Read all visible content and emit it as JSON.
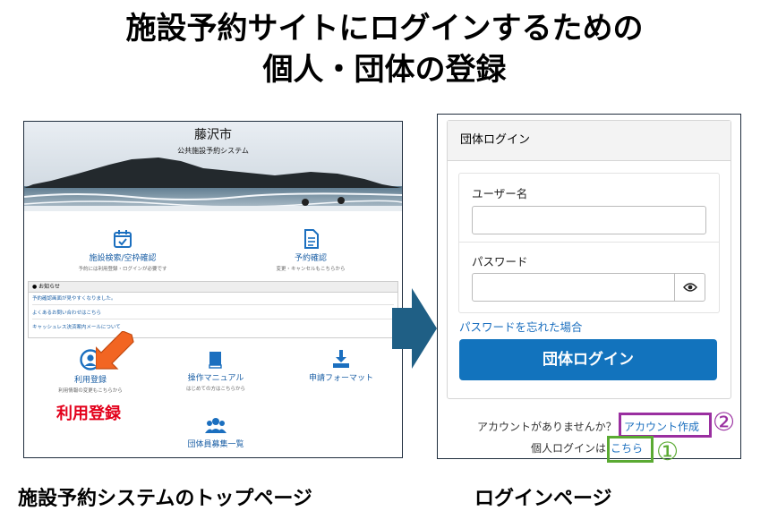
{
  "slide": {
    "title_line1": "施設予約サイトにログインするための",
    "title_line2": "個人・団体の登録",
    "caption_left": "施設予約システムのトップページ",
    "caption_right": "ログインページ",
    "red_label": "利用登録",
    "callout_1": "①",
    "callout_2": "②"
  },
  "top_page": {
    "city": "藤沢市",
    "system_name": "公共施設予約システム",
    "tiles": [
      {
        "label": "施設検索/空枠確認",
        "sub": "予約には利用登録・ログインが必要です",
        "icon": "calendar-check-icon"
      },
      {
        "label": "予約確認",
        "sub": "変更・キャンセルもこちらから",
        "icon": "document-icon"
      },
      {
        "label": "利用登録",
        "sub": "利用情報の変更もこちらから",
        "icon": "user-circle-icon"
      },
      {
        "label": "操作マニュアル",
        "sub": "はじめての方はこちらから",
        "icon": "book-icon"
      },
      {
        "label": "申請フォーマット",
        "sub": "",
        "icon": "download-icon"
      },
      {
        "label": "団体員募集一覧",
        "sub": "",
        "icon": "users-icon"
      }
    ],
    "notice": {
      "heading": "お知らせ",
      "items": [
        "予約確認画面が見やすくなりました。",
        "よくあるお問い合わせはこちら",
        "キャッシュレス決済案内メールについて"
      ]
    }
  },
  "login_page": {
    "card_title": "団体ログイン",
    "username_label": "ユーザー名",
    "password_label": "パスワード",
    "forgot_password": "パスワードを忘れた場合",
    "login_button": "団体ログイン",
    "no_account_text": "アカウントがありませんか？",
    "create_account_link": "アカウント作成",
    "personal_login_text": "個人ログインは",
    "personal_login_link": "こちら"
  },
  "colors": {
    "link_blue": "#1b6fbf",
    "button_blue": "#1273bd",
    "red": "#e3001b",
    "orange_arrow": "#f26522",
    "callout_green": "#5aaa32",
    "callout_purple": "#9a2fa0",
    "big_arrow": "#1f5f85"
  }
}
